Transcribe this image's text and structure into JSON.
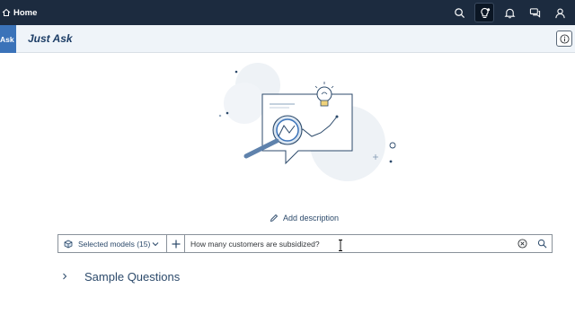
{
  "shell": {
    "home_label": "Home",
    "icons": [
      "search-icon",
      "lightbulb-icon",
      "bell-icon",
      "chat-icon",
      "user-icon"
    ]
  },
  "subheader": {
    "tab_label": "Ask",
    "title": "Just Ask"
  },
  "main": {
    "add_description_label": "Add description",
    "model_select_label": "Selected models (15)",
    "query_value": "How many customers are subsidized?",
    "sample_questions_label": "Sample Questions"
  },
  "colors": {
    "shell_bg": "#1c2b3f",
    "subheader_bg": "#eff4f9",
    "accent": "#3b73b9",
    "text_link": "#2c4a6b"
  }
}
